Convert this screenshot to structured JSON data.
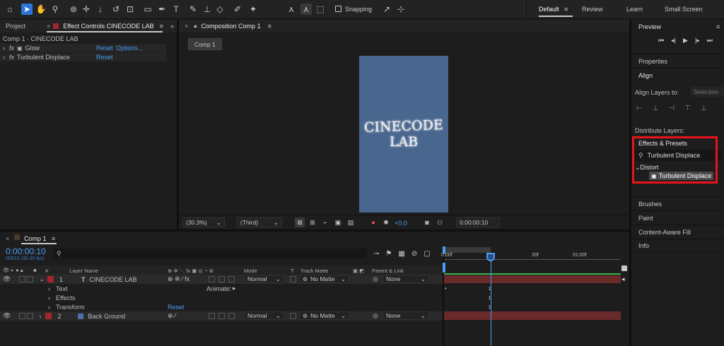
{
  "toolbar": {
    "snapping": "Snapping",
    "workspaces": [
      "Default",
      "Review",
      "Learn",
      "Small Screen"
    ]
  },
  "effect_controls": {
    "tab_project": "Project",
    "tab_effect": "Effect Controls CINECODE LAB",
    "comp_label": "Comp 1 · CINECODE LAB",
    "effects": [
      {
        "name": "Glow",
        "reset": "Reset",
        "options": "Options..."
      },
      {
        "name": "Turbulent Displace",
        "reset": "Reset"
      }
    ]
  },
  "composition": {
    "tab": "Composition Comp 1",
    "comp_button": "Comp 1",
    "canvas_text_line1": "CINECODE",
    "canvas_text_line2": "LAB",
    "canvas_color": "#49668e",
    "zoom": "(30.3%)",
    "resolution": "(Third)",
    "exposure": "+0.0",
    "timecode": "0:00:00:10"
  },
  "right_panel": {
    "preview": "Preview",
    "properties": "Properties",
    "align": "Align",
    "align_layers_to": "Align Layers to:",
    "selection": "Selection",
    "distribute_layers": "Distribute Layers:",
    "effects_presets": "Effects & Presets",
    "search_value": "Turbulent Displace",
    "category": "Distort",
    "result": "Turbulent Displace",
    "panels": [
      "Brushes",
      "Paint",
      "Content-Aware Fill",
      "Info"
    ]
  },
  "timeline": {
    "tab": "Comp 1",
    "timecode": "0:00:00:10",
    "frames": "00010 (30.00 fps)",
    "columns": {
      "num": "#",
      "layer_name": "Layer Name",
      "mode": "Mode",
      "t": "T",
      "track_matte": "Track Matte",
      "parent": "Parent & Link"
    },
    "ruler": [
      "0:00f",
      "20f",
      "01:00f"
    ],
    "layers": [
      {
        "num": "1",
        "type": "T",
        "name": "CINECODE LAB",
        "mode": "Normal",
        "matte": "No Matte",
        "parent": "None",
        "color": "#a5252c"
      },
      {
        "num": "2",
        "type": "",
        "name": "Back Ground",
        "mode": "Normal",
        "matte": "No Matte",
        "parent": "None",
        "color": "#a5252c"
      }
    ],
    "sub_rows": [
      {
        "label": "Text",
        "extra": "Animate:"
      },
      {
        "label": "Effects",
        "extra": ""
      },
      {
        "label": "Transform",
        "extra": "Reset"
      }
    ]
  },
  "colors": {
    "accent": "#4a9cf5",
    "highlight_box": "#e8141b",
    "track_bar": "#6b2a2a"
  }
}
